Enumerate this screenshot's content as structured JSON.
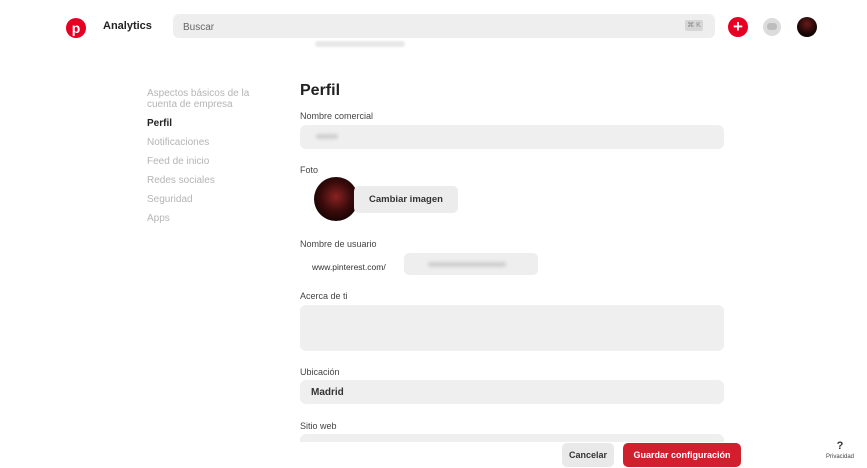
{
  "header": {
    "logo_letter": "p",
    "section": "Analytics",
    "search_placeholder": "Buscar",
    "search_kbd": "⌘ K",
    "plus": "+"
  },
  "nav": {
    "items": [
      {
        "label": "Aspectos básicos de la cuenta de empresa"
      },
      {
        "label": "Perfil"
      },
      {
        "label": "Notificaciones"
      },
      {
        "label": "Feed de inicio"
      },
      {
        "label": "Redes sociales"
      },
      {
        "label": "Seguridad"
      },
      {
        "label": "Apps"
      }
    ]
  },
  "profile": {
    "title": "Perfil",
    "business_name_label": "Nombre comercial",
    "photo_label": "Foto",
    "change_image": "Cambiar imagen",
    "username_label": "Nombre de usuario",
    "url_prefix": "www.pinterest.com/",
    "about_label": "Acerca de ti",
    "location_label": "Ubicación",
    "location_value": "Madrid",
    "website_label": "Sitio web"
  },
  "actions": {
    "cancel": "Cancelar",
    "save": "Guardar configuración"
  },
  "help": {
    "symbol": "?",
    "label": "Privacidad"
  }
}
